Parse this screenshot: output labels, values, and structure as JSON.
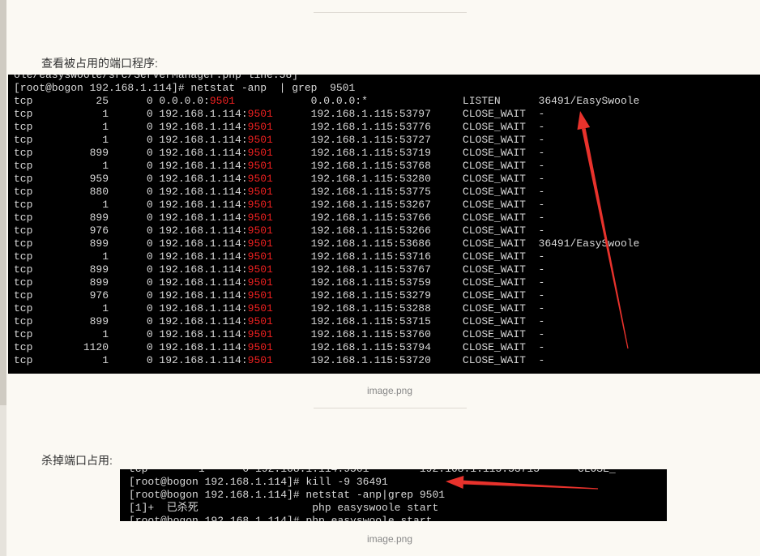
{
  "captions": {
    "image1": "image.png",
    "image2": "image.png"
  },
  "section1": {
    "label": "查看被占用的端口程序:"
  },
  "section2": {
    "label": "杀掉端口占用:"
  },
  "term1": {
    "partial_line": "ole/easyswoole/src/ServerManager.php line:58]",
    "prompt": "[root@bogon 192.168.1.114]# netstat -anp  | grep  9501",
    "rows": [
      {
        "proto": "tcp",
        "recvq": "25",
        "sendq": "0",
        "local_ip": "0.0.0.0:",
        "port": "9501",
        "foreign": "0.0.0.0:*",
        "state": "LISTEN",
        "pid": "36491/EasySwoole"
      },
      {
        "proto": "tcp",
        "recvq": "1",
        "sendq": "0",
        "local_ip": "192.168.1.114:",
        "port": "9501",
        "foreign": "192.168.1.115:53797",
        "state": "CLOSE_WAIT",
        "pid": "-"
      },
      {
        "proto": "tcp",
        "recvq": "1",
        "sendq": "0",
        "local_ip": "192.168.1.114:",
        "port": "9501",
        "foreign": "192.168.1.115:53776",
        "state": "CLOSE_WAIT",
        "pid": "-"
      },
      {
        "proto": "tcp",
        "recvq": "1",
        "sendq": "0",
        "local_ip": "192.168.1.114:",
        "port": "9501",
        "foreign": "192.168.1.115:53727",
        "state": "CLOSE_WAIT",
        "pid": "-"
      },
      {
        "proto": "tcp",
        "recvq": "899",
        "sendq": "0",
        "local_ip": "192.168.1.114:",
        "port": "9501",
        "foreign": "192.168.1.115:53719",
        "state": "CLOSE_WAIT",
        "pid": "-"
      },
      {
        "proto": "tcp",
        "recvq": "1",
        "sendq": "0",
        "local_ip": "192.168.1.114:",
        "port": "9501",
        "foreign": "192.168.1.115:53768",
        "state": "CLOSE_WAIT",
        "pid": "-"
      },
      {
        "proto": "tcp",
        "recvq": "959",
        "sendq": "0",
        "local_ip": "192.168.1.114:",
        "port": "9501",
        "foreign": "192.168.1.115:53280",
        "state": "CLOSE_WAIT",
        "pid": "-"
      },
      {
        "proto": "tcp",
        "recvq": "880",
        "sendq": "0",
        "local_ip": "192.168.1.114:",
        "port": "9501",
        "foreign": "192.168.1.115:53775",
        "state": "CLOSE_WAIT",
        "pid": "-"
      },
      {
        "proto": "tcp",
        "recvq": "1",
        "sendq": "0",
        "local_ip": "192.168.1.114:",
        "port": "9501",
        "foreign": "192.168.1.115:53267",
        "state": "CLOSE_WAIT",
        "pid": "-"
      },
      {
        "proto": "tcp",
        "recvq": "899",
        "sendq": "0",
        "local_ip": "192.168.1.114:",
        "port": "9501",
        "foreign": "192.168.1.115:53766",
        "state": "CLOSE_WAIT",
        "pid": "-"
      },
      {
        "proto": "tcp",
        "recvq": "976",
        "sendq": "0",
        "local_ip": "192.168.1.114:",
        "port": "9501",
        "foreign": "192.168.1.115:53266",
        "state": "CLOSE_WAIT",
        "pid": "-"
      },
      {
        "proto": "tcp",
        "recvq": "899",
        "sendq": "0",
        "local_ip": "192.168.1.114:",
        "port": "9501",
        "foreign": "192.168.1.115:53686",
        "state": "CLOSE_WAIT",
        "pid": "36491/EasySwoole"
      },
      {
        "proto": "tcp",
        "recvq": "1",
        "sendq": "0",
        "local_ip": "192.168.1.114:",
        "port": "9501",
        "foreign": "192.168.1.115:53716",
        "state": "CLOSE_WAIT",
        "pid": "-"
      },
      {
        "proto": "tcp",
        "recvq": "899",
        "sendq": "0",
        "local_ip": "192.168.1.114:",
        "port": "9501",
        "foreign": "192.168.1.115:53767",
        "state": "CLOSE_WAIT",
        "pid": "-"
      },
      {
        "proto": "tcp",
        "recvq": "899",
        "sendq": "0",
        "local_ip": "192.168.1.114:",
        "port": "9501",
        "foreign": "192.168.1.115:53759",
        "state": "CLOSE_WAIT",
        "pid": "-"
      },
      {
        "proto": "tcp",
        "recvq": "976",
        "sendq": "0",
        "local_ip": "192.168.1.114:",
        "port": "9501",
        "foreign": "192.168.1.115:53279",
        "state": "CLOSE_WAIT",
        "pid": "-"
      },
      {
        "proto": "tcp",
        "recvq": "1",
        "sendq": "0",
        "local_ip": "192.168.1.114:",
        "port": "9501",
        "foreign": "192.168.1.115:53288",
        "state": "CLOSE_WAIT",
        "pid": "-"
      },
      {
        "proto": "tcp",
        "recvq": "899",
        "sendq": "0",
        "local_ip": "192.168.1.114:",
        "port": "9501",
        "foreign": "192.168.1.115:53715",
        "state": "CLOSE_WAIT",
        "pid": "-"
      },
      {
        "proto": "tcp",
        "recvq": "1",
        "sendq": "0",
        "local_ip": "192.168.1.114:",
        "port": "9501",
        "foreign": "192.168.1.115:53760",
        "state": "CLOSE_WAIT",
        "pid": "-"
      },
      {
        "proto": "tcp",
        "recvq": "1120",
        "sendq": "0",
        "local_ip": "192.168.1.114:",
        "port": "9501",
        "foreign": "192.168.1.115:53794",
        "state": "CLOSE_WAIT",
        "pid": "-"
      },
      {
        "proto": "tcp",
        "recvq": "1",
        "sendq": "0",
        "local_ip": "192.168.1.114:",
        "port": "9501",
        "foreign": "192.168.1.115:53720",
        "state": "CLOSE_WAIT",
        "pid": "-"
      }
    ]
  },
  "term2": {
    "partial_line": "tcp        1      0 192.168.1.114:9501        192.168.1.115:53715      CLOSE_",
    "lines": [
      "[root@bogon 192.168.1.114]# kill -9 36491",
      "[root@bogon 192.168.1.114]# netstat -anp|grep 9501",
      "[1]+  已杀死                  php easyswoole start"
    ],
    "cut_line": "[root@bogon 192.168.1.114]# php easyswoole start"
  },
  "colors": {
    "port_highlight": "#ef2020",
    "arrow": "#e8322c",
    "terminal_bg": "#000000"
  }
}
